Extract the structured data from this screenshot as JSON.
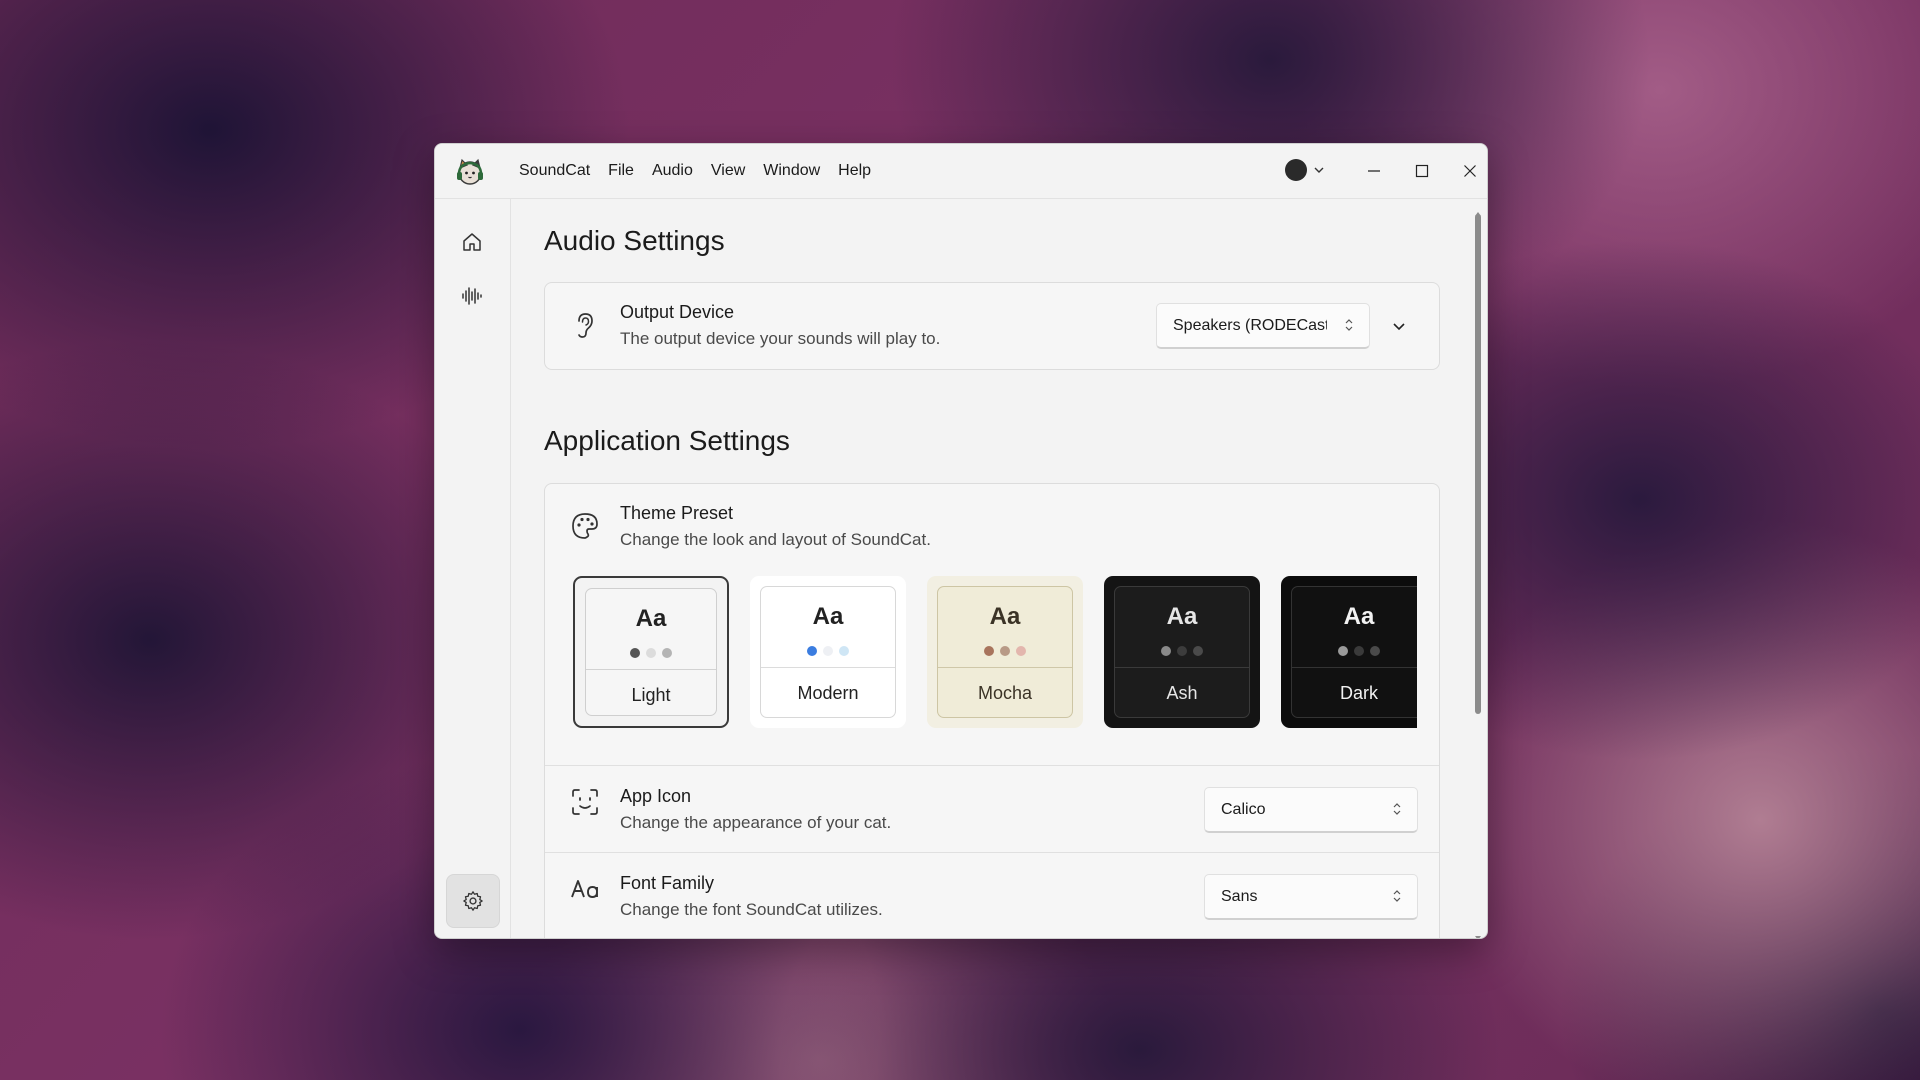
{
  "titlebar": {
    "menu": [
      "SoundCat",
      "File",
      "Audio",
      "View",
      "Window",
      "Help"
    ]
  },
  "sidebar": {
    "items": [
      {
        "name": "home-icon"
      },
      {
        "name": "waveform-icon"
      },
      {
        "name": "gear-icon",
        "active": true
      }
    ]
  },
  "audio_settings": {
    "heading": "Audio Settings",
    "output_device": {
      "title": "Output Device",
      "description": "The output device your sounds will play to.",
      "value": "Speakers (RODECaster Pro II Main Stereo)"
    }
  },
  "app_settings": {
    "heading": "Application Settings",
    "theme_preset": {
      "title": "Theme Preset",
      "description": "Change the look and layout of SoundCat.",
      "sample": "Aa",
      "themes": [
        {
          "name": "Light",
          "selected": true
        },
        {
          "name": "Modern"
        },
        {
          "name": "Mocha"
        },
        {
          "name": "Ash"
        },
        {
          "name": "Dark"
        }
      ]
    },
    "app_icon": {
      "title": "App Icon",
      "description": "Change the appearance of your cat.",
      "value": "Calico"
    },
    "font_family": {
      "title": "Font Family",
      "description": "Change the font SoundCat utilizes.",
      "value": "Sans"
    }
  },
  "colors": {
    "window_bg": "#f3f3f3",
    "card_bg": "#f6f6f6",
    "accent_blue": "#3b7de0"
  }
}
